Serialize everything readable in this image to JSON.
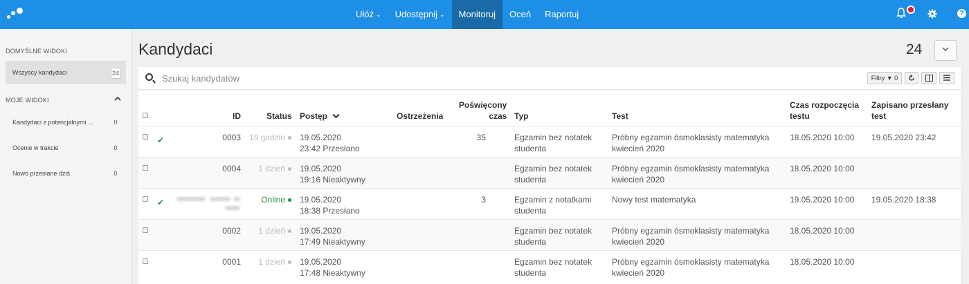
{
  "topbar": {
    "nav": [
      {
        "label": "Ułóż",
        "has_caret": true
      },
      {
        "label": "Udostępnij",
        "has_caret": true
      },
      {
        "label": "Monitoruj",
        "active": true
      },
      {
        "label": "Oceń"
      },
      {
        "label": "Raportuj"
      }
    ],
    "help": "?",
    "icons": [
      "logo-dots",
      "bell-icon",
      "gear-icon",
      "help-icon"
    ]
  },
  "sidebar": {
    "default_heading": "DOMYŚLNE WIDOKI",
    "default_items": [
      {
        "label": "Wszyscy kandydaci",
        "count": "24"
      }
    ],
    "my_heading": "MOJE WIDOKI",
    "my_items": [
      {
        "label": "Kandydaci z potencjalnymi ...",
        "count": "0"
      },
      {
        "label": "Ocenie w trakcie",
        "count": "0"
      },
      {
        "label": "Nowo przesłane dziś",
        "count": "0"
      }
    ]
  },
  "main": {
    "title": "Kandydaci",
    "total": "24",
    "search_placeholder": "Szukaj kandydatów",
    "filters_label": "Filtry ▼ 0"
  },
  "table": {
    "headers": {
      "id": "ID",
      "status": "Status",
      "progress": "Postęp",
      "warnings": "Ostrzeżenia",
      "time_l1": "Poświęcony",
      "time_l2": "czas",
      "type": "Typ",
      "test": "Test",
      "start_l1": "Czas rozpoczęcia",
      "start_l2": "testu",
      "saved_l1": "Zapisano przesłany",
      "saved_l2": "test"
    },
    "rows": [
      {
        "checked": true,
        "id": "0003",
        "status": "19 godzin",
        "status_color": "#bbbbbb",
        "p1": "19.05.2020",
        "p2": "23:42 Przesłano",
        "time": "35",
        "t1": "Egzamin bez notatek",
        "t2": "studenta",
        "test1": "Próbny egzamin ósmoklasisty matematyka",
        "test2": "kwiecień 2020",
        "start": "18.05.2020 10:00",
        "saved": "19.05.2020 23:42"
      },
      {
        "checked": false,
        "id": "0004",
        "status": "1 dzień",
        "status_color": "#bbbbbb",
        "p1": "19.05.2020",
        "p2": "19:16 Nieaktywny",
        "time": "",
        "t1": "Egzamin bez notatek",
        "t2": "studenta",
        "test1": "Próbny egzamin ósmoklasisty matematyka",
        "test2": "kwiecień 2020",
        "start": "18.05.2020 10:00",
        "saved": ""
      },
      {
        "checked": true,
        "id": "",
        "status": "Online",
        "status_color": "#2e8b3e",
        "p1": "19.05.2020",
        "p2": "18:38 Przesłano",
        "time": "3",
        "t1": "Egzamin z notatkami",
        "t2": "studenta",
        "test1": "Nowy test matematyka",
        "test2": "",
        "start": "19.05.2020 10:00",
        "saved": "19.05.2020 18:38"
      },
      {
        "checked": false,
        "id": "0002",
        "status": "1 dzień",
        "status_color": "#bbbbbb",
        "p1": "19.05.2020",
        "p2": "17:49 Nieaktywny",
        "time": "",
        "t1": "Egzamin bez notatek",
        "t2": "studenta",
        "test1": "Próbny egzamin ósmoklasisty matematyka",
        "test2": "kwiecień 2020",
        "start": "18.05.2020 10:00",
        "saved": ""
      },
      {
        "checked": false,
        "id": "0001",
        "status": "1 dzień",
        "status_color": "#bbbbbb",
        "p1": "19.05.2020",
        "p2": "17:48 Nieaktywny",
        "time": "",
        "t1": "Egzamin bez notatek",
        "t2": "studenta",
        "test1": "Próbny egzamin ósmoklasisty matematyka",
        "test2": "kwiecień 2020",
        "start": "18.05.2020 10:00",
        "saved": ""
      }
    ]
  }
}
